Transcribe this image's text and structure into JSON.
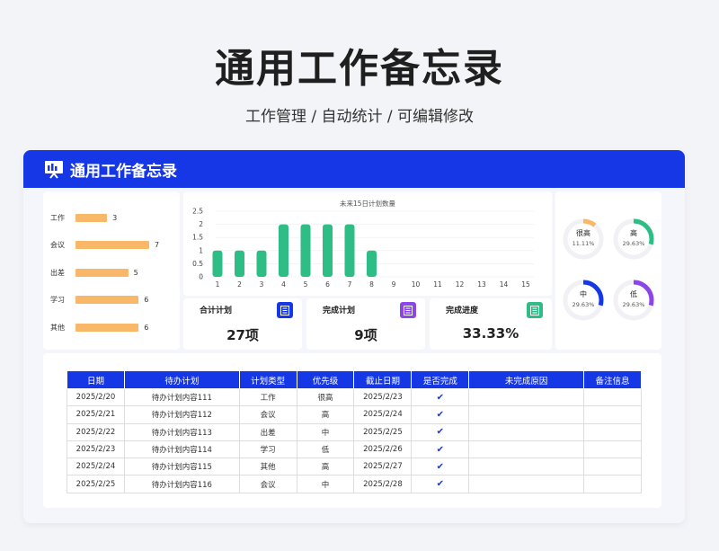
{
  "page": {
    "title": "通用工作备忘录",
    "subtitle": "工作管理 / 自动统计 /  可编辑修改"
  },
  "card": {
    "title": "通用工作备忘录"
  },
  "category_bars": [
    {
      "label": "工作",
      "value": 3
    },
    {
      "label": "会议",
      "value": 7
    },
    {
      "label": "出差",
      "value": 5
    },
    {
      "label": "学习",
      "value": 6
    },
    {
      "label": "其他",
      "value": 6
    }
  ],
  "chart_data": {
    "type": "bar",
    "title": "未来15日计划数量",
    "categories": [
      "1",
      "2",
      "3",
      "4",
      "5",
      "6",
      "7",
      "8",
      "9",
      "10",
      "11",
      "12",
      "13",
      "14",
      "15"
    ],
    "values": [
      1,
      1,
      1,
      2,
      2,
      2,
      2,
      1,
      0,
      0,
      0,
      0,
      0,
      0,
      0
    ],
    "ylim": [
      0,
      2.5
    ],
    "yticks": [
      "0",
      "0.5",
      "1",
      "1.5",
      "2",
      "2.5"
    ],
    "bar_color": "#2dbd85"
  },
  "kpis": [
    {
      "label": "合计计划",
      "value": "27项",
      "color": "#1537e6"
    },
    {
      "label": "完成计划",
      "value": "9项",
      "color": "#8b46e8"
    },
    {
      "label": "完成进度",
      "value": "33.33%",
      "color": "#2dbd85"
    }
  ],
  "donuts": [
    {
      "label": "很高",
      "pct": "11.11%",
      "fraction": 0.1111,
      "color": "#f8b868"
    },
    {
      "label": "高",
      "pct": "29.63%",
      "fraction": 0.2963,
      "color": "#2dbd85"
    },
    {
      "label": "中",
      "pct": "29.63%",
      "fraction": 0.2963,
      "color": "#1537e6"
    },
    {
      "label": "低",
      "pct": "29.63%",
      "fraction": 0.2963,
      "color": "#8b46e8"
    }
  ],
  "table": {
    "headers": [
      "日期",
      "待办计划",
      "计划类型",
      "优先级",
      "截止日期",
      "是否完成",
      "未完成原因",
      "备注信息"
    ],
    "rows": [
      [
        "2025/2/20",
        "待办计划内容111",
        "工作",
        "很高",
        "2025/2/23",
        "✔",
        "",
        ""
      ],
      [
        "2025/2/21",
        "待办计划内容112",
        "会议",
        "高",
        "2025/2/24",
        "✔",
        "",
        ""
      ],
      [
        "2025/2/22",
        "待办计划内容113",
        "出差",
        "中",
        "2025/2/25",
        "✔",
        "",
        ""
      ],
      [
        "2025/2/23",
        "待办计划内容114",
        "学习",
        "低",
        "2025/2/26",
        "✔",
        "",
        ""
      ],
      [
        "2025/2/24",
        "待办计划内容115",
        "其他",
        "高",
        "2025/2/27",
        "✔",
        "",
        ""
      ],
      [
        "2025/2/25",
        "待办计划内容116",
        "会议",
        "中",
        "2025/2/28",
        "✔",
        "",
        ""
      ]
    ]
  }
}
